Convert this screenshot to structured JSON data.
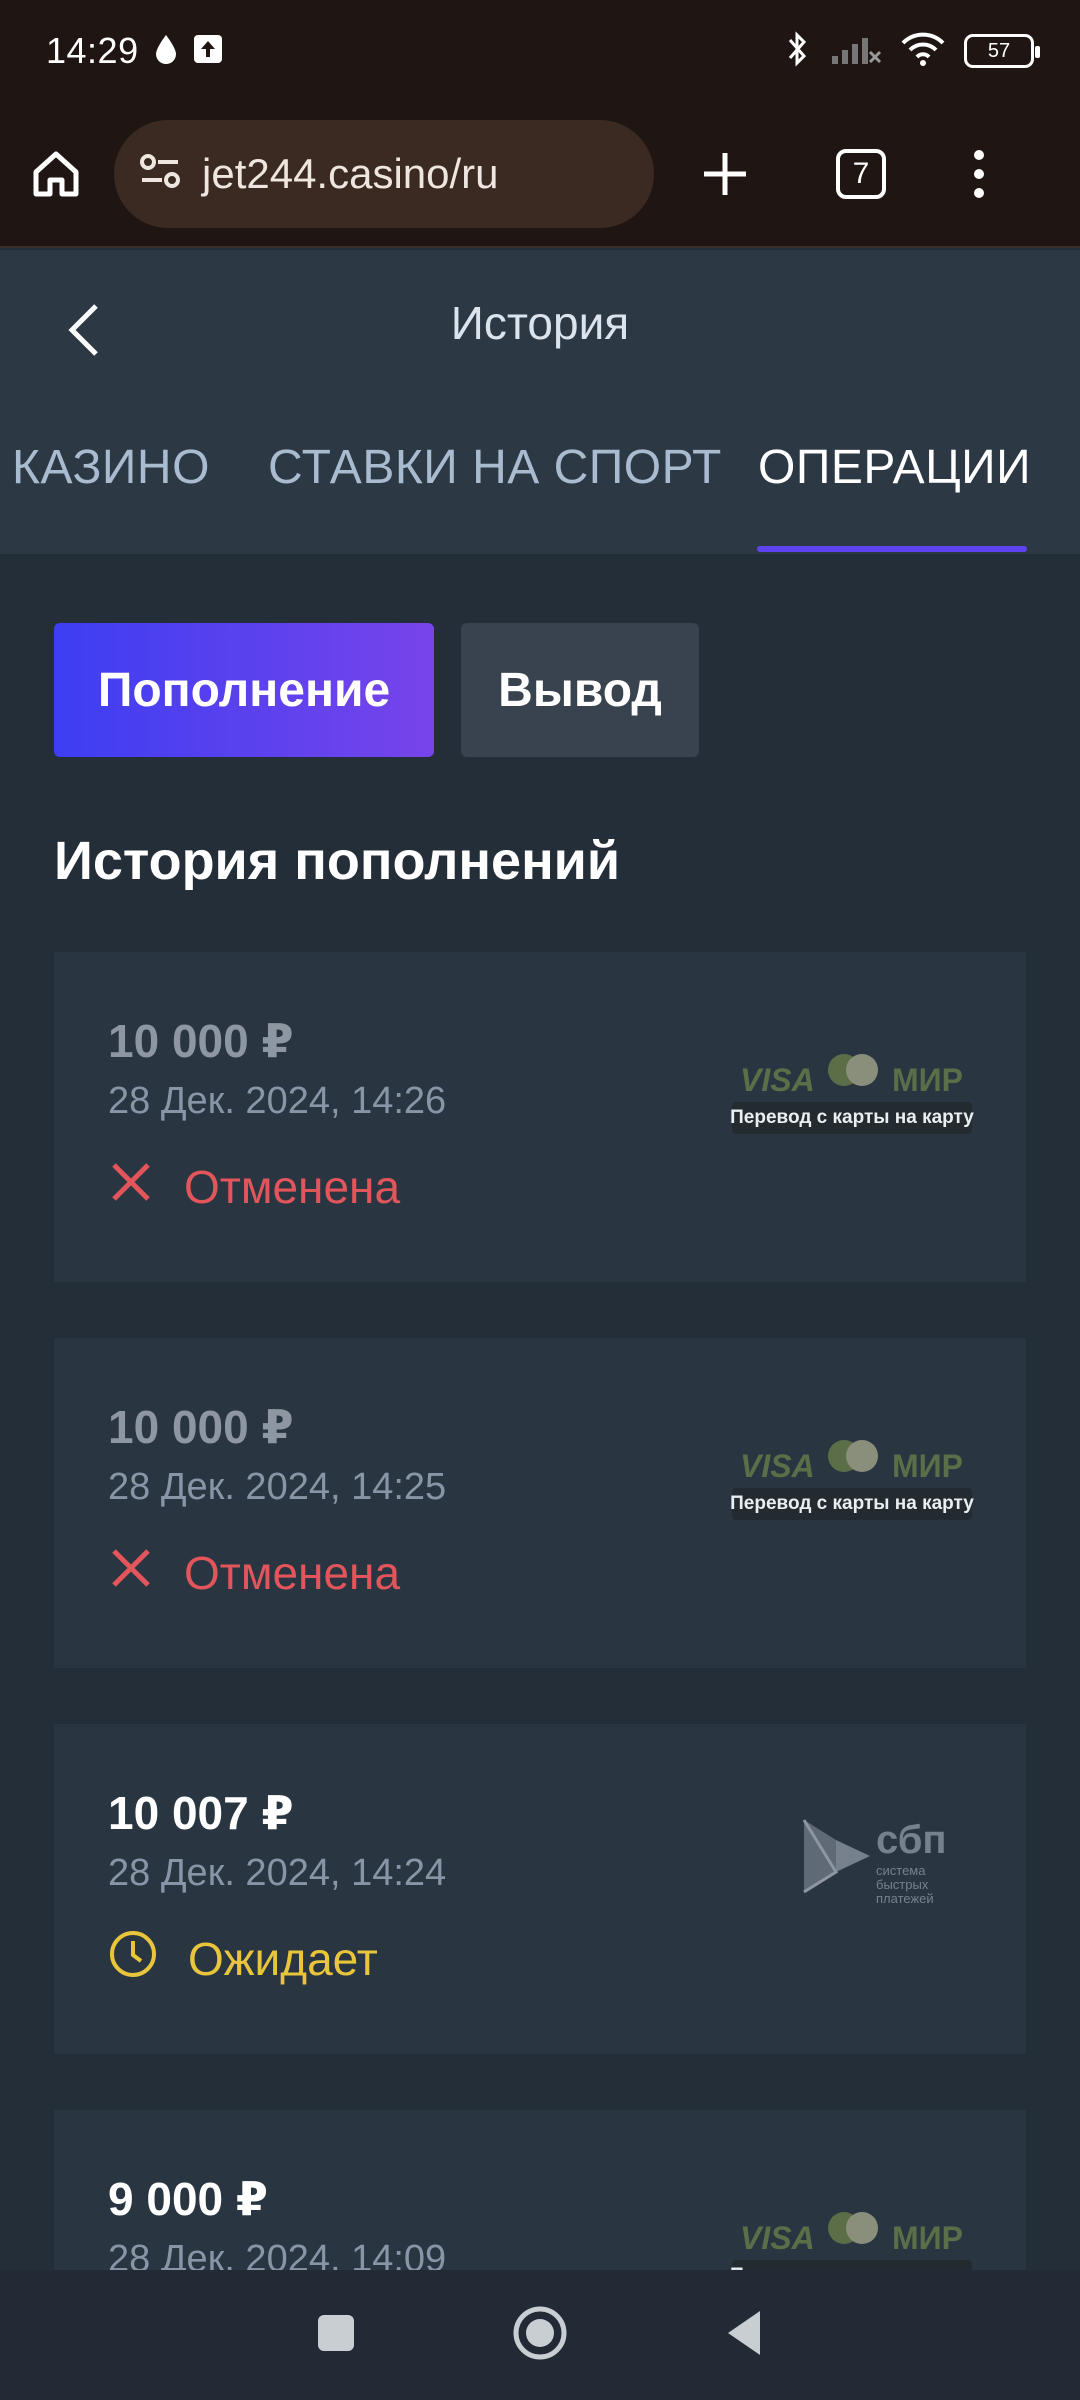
{
  "status_bar": {
    "time": "14:29",
    "battery": "57",
    "icons": [
      "water-drop-icon",
      "upload-icon",
      "bluetooth-icon",
      "signal-icon",
      "wifi-icon"
    ]
  },
  "browser": {
    "url": "jet244.casino/ru",
    "tab_count": "7"
  },
  "header": {
    "title": "История"
  },
  "tabs": [
    {
      "label": "КАЗИНО",
      "active": false
    },
    {
      "label": "СТАВКИ НА СПОРТ",
      "active": false
    },
    {
      "label": "ОПЕРАЦИИ",
      "active": true
    }
  ],
  "segments": {
    "deposit": "Пополнение",
    "withdraw": "Вывод"
  },
  "section_title": "История пополнений",
  "payment_methods": {
    "card_transfer": {
      "visa": "VISA",
      "mir": "МИР",
      "caption": "Перевод с карты на карту"
    },
    "sbp": {
      "name": "сбп",
      "subtitle": "система быстрых платежей"
    }
  },
  "transactions": [
    {
      "amount": "10 000 ₽",
      "date": "28 Дек. 2024, 14:26",
      "status": "Отменена",
      "status_type": "cancelled",
      "method": "card_transfer"
    },
    {
      "amount": "10 000 ₽",
      "date": "28 Дек. 2024, 14:25",
      "status": "Отменена",
      "status_type": "cancelled",
      "method": "card_transfer"
    },
    {
      "amount": "10 007 ₽",
      "date": "28 Дек. 2024, 14:24",
      "status": "Ожидает",
      "status_type": "pending",
      "method": "sbp"
    },
    {
      "amount": "9 000 ₽",
      "date": "28 Дек. 2024, 14:09",
      "status": "",
      "status_type": "",
      "method": "card_transfer"
    }
  ],
  "colors": {
    "accent": "#5d43f0",
    "cancelled": "#e2555a",
    "pending": "#e8c53a"
  }
}
